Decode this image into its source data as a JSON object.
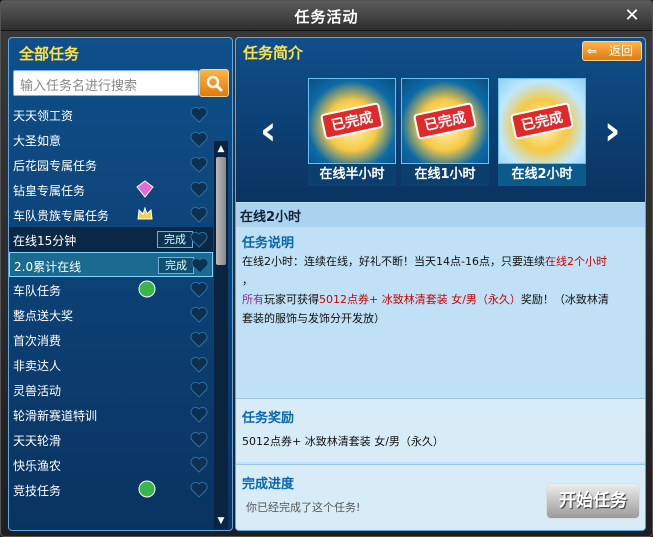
{
  "window": {
    "title": "任务活动",
    "close_label": "✕"
  },
  "left": {
    "header": "全部任务",
    "search_placeholder": "输入任务名进行搜索",
    "tasks": [
      {
        "label": "天天领工资"
      },
      {
        "label": "大圣如意"
      },
      {
        "label": "后花园专属任务"
      },
      {
        "label": "钻皇专属任务"
      },
      {
        "label": "车队贵族专属任务"
      },
      {
        "label": "在线15分钟",
        "status": "完成"
      },
      {
        "label": "2.0累计在线",
        "status": "完成"
      },
      {
        "label": "车队任务"
      },
      {
        "label": "整点送大奖"
      },
      {
        "label": "首次消费"
      },
      {
        "label": "非卖达人"
      },
      {
        "label": "灵兽活动"
      },
      {
        "label": "轮滑新赛道特训"
      },
      {
        "label": "天天轮滑"
      },
      {
        "label": "快乐渔农"
      },
      {
        "label": "竞技任务"
      }
    ]
  },
  "right": {
    "header": "任务简介",
    "back_label": "返回",
    "cards": [
      {
        "label": "在线半小时",
        "stamp": "已完成"
      },
      {
        "label": "在线1小时",
        "stamp": "已完成"
      },
      {
        "label": "在线2小时",
        "stamp": "已完成"
      }
    ],
    "task_name": "在线2小时",
    "desc_title": "任务说明",
    "desc_line1_a": "在线2小时：连续在线，好礼不断！当天14点-16点，只要连续",
    "desc_line1_red": "在线2个小时",
    "desc_line2": "，",
    "desc_line3_purple": "所有",
    "desc_line3_a": "玩家可获得",
    "desc_line3_red": "5012点券+ 冰致林清套装 女/男（永久）",
    "desc_line3_b": "奖励！（冰致林清",
    "desc_line4": "套装的服饰与发饰分开发放）",
    "reward_title": "任务奖励",
    "reward_text": "5012点券+ 冰致林清套装 女/男（永久）",
    "progress_title": "完成进度",
    "progress_text": "你已经完成了这个任务!",
    "start_label": "开始任务"
  }
}
